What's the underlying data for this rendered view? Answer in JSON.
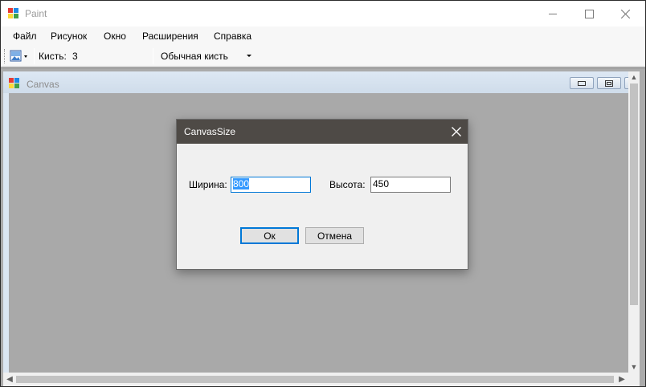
{
  "app": {
    "title": "Paint",
    "icon": "paint-app-icon"
  },
  "window_controls": {
    "minimize_icon": "minimize-icon",
    "maximize_icon": "maximize-icon",
    "close_icon": "close-icon"
  },
  "menu": {
    "items": [
      {
        "label": "Файл"
      },
      {
        "label": "Рисунок"
      },
      {
        "label": "Окно"
      },
      {
        "label": "Расширения"
      },
      {
        "label": "Справка"
      }
    ]
  },
  "toolbar": {
    "image_button_icon": "image-dropdown-icon",
    "brush_label": "Кисть:",
    "brush_value": "3",
    "brush_type": "Обычная кисть"
  },
  "child_window": {
    "title": "Canvas",
    "icon": "paint-app-icon",
    "canvas_color": "#a9a9a9"
  },
  "dialog": {
    "title": "CanvasSize",
    "width_label": "Ширина:",
    "width_value": "800",
    "height_label": "Высота:",
    "height_value": "450",
    "ok_label": "Ок",
    "cancel_label": "Отмена"
  },
  "colors": {
    "dialog_titlebar": "#4e4a46",
    "focus_accent": "#0078d7",
    "selection": "#3399ff",
    "mdi_background": "#ababab"
  }
}
